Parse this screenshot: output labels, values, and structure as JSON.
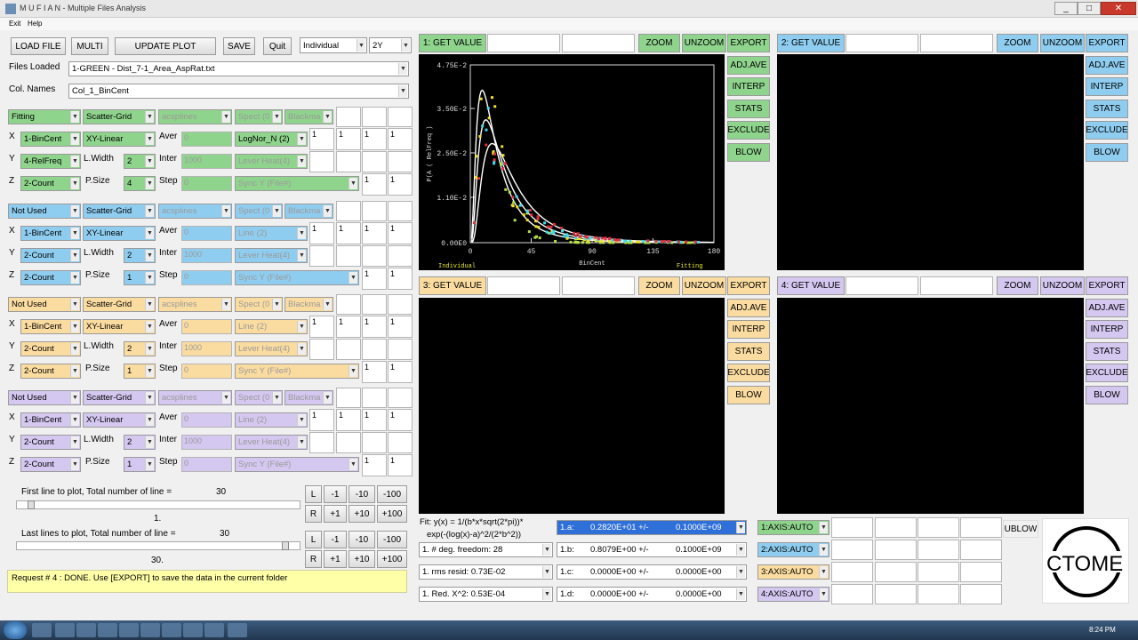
{
  "window": {
    "title": "M U F I A N - Multiple Files Analysis",
    "min": "_",
    "max": "□",
    "close": "✕"
  },
  "menu": {
    "exit": "Exit",
    "help": "Help"
  },
  "toolbar": {
    "load": "LOAD FILE",
    "multi": "MULTI",
    "update": "UPDATE PLOT",
    "save": "SAVE",
    "quit": "Quit",
    "mode": "Individual",
    "axes": "2Y"
  },
  "files_loaded": {
    "label": "Files Loaded",
    "value": "1-GREEN - Dist_7-1_Area_AspRat.txt"
  },
  "col_names": {
    "label": "Col. Names",
    "value": "Col_1_BinCent"
  },
  "groups": [
    {
      "mode": "Fitting",
      "style": "Scatter-Grid",
      "spline": "acsplines",
      "speed": "Spect (0",
      "window": "Blackma",
      "x": "1-BinCent",
      "scale": "XY-Linear",
      "aver": "0",
      "fitfn": "LogNor_N (2)",
      "y": "4-RelFreq",
      "lwidth": "2",
      "inter": "1000",
      "lever": "Lever Heat(4)",
      "z": "2-Count",
      "psize": "4",
      "step": "0",
      "sync": "Sync Y (File#)",
      "n": [
        "1",
        "1",
        "1",
        "1"
      ],
      "m": [
        "1",
        "1"
      ]
    },
    {
      "mode": "Not Used",
      "style": "Scatter-Grid",
      "spline": "acsplines",
      "speed": "Spect (0",
      "window": "Blackma",
      "x": "1-BinCent",
      "scale": "XY-Linear",
      "aver": "0",
      "fitfn": "Line (2)",
      "y": "2-Count",
      "lwidth": "2",
      "inter": "1000",
      "lever": "Lever Heat(4)",
      "z": "2-Count",
      "psize": "1",
      "step": "0",
      "sync": "Sync Y (File#)",
      "n": [
        "1",
        "1",
        "1",
        "1"
      ],
      "m": [
        "1",
        "1"
      ]
    },
    {
      "mode": "Not Used",
      "style": "Scatter-Grid",
      "spline": "acsplines",
      "speed": "Spect (0",
      "window": "Blackma",
      "x": "1-BinCent",
      "scale": "XY-Linear",
      "aver": "0",
      "fitfn": "Line (2)",
      "y": "2-Count",
      "lwidth": "2",
      "inter": "1000",
      "lever": "Lever Heat(4)",
      "z": "2-Count",
      "psize": "1",
      "step": "0",
      "sync": "Sync Y (File#)",
      "n": [
        "1",
        "1",
        "1",
        "1"
      ],
      "m": [
        "1",
        "1"
      ]
    },
    {
      "mode": "Not Used",
      "style": "Scatter-Grid",
      "spline": "acsplines",
      "speed": "Spect (0",
      "window": "Blackma",
      "x": "1-BinCent",
      "scale": "XY-Linear",
      "aver": "0",
      "fitfn": "Line (2)",
      "y": "2-Count",
      "lwidth": "2",
      "inter": "1000",
      "lever": "Lever Heat(4)",
      "z": "2-Count",
      "psize": "1",
      "step": "0",
      "sync": "Sync Y (File#)",
      "n": [
        "1",
        "1",
        "1",
        "1"
      ],
      "m": [
        "1",
        "1"
      ]
    }
  ],
  "labels": {
    "x": "X",
    "y": "Y",
    "z": "Z",
    "aver": "Aver",
    "lwidth": "L.Width",
    "inter": "Inter",
    "psize": "P.Size",
    "step": "Step"
  },
  "lines": {
    "first_label": "First line to plot, Total number of line =",
    "first_total": "30",
    "first_value": "1.",
    "last_label": "Last lines to plot, Total number of line =",
    "last_total": "30",
    "last_value": "30.",
    "btn": [
      "L",
      "-1",
      "-10",
      "-100",
      "R",
      "+1",
      "+10",
      "+100"
    ]
  },
  "request": "Request #     4 : DONE. Use [EXPORT] to save the data in the current folder",
  "panels": [
    {
      "get": "1: GET VALUE",
      "zoom": "ZOOM",
      "unzoom": "UNZOOM",
      "export": "EXPORT",
      "adj": "ADJ.AVE",
      "interp": "INTERP",
      "stats": "STATS",
      "exclude": "EXCLUDE",
      "blow": "BLOW"
    },
    {
      "get": "2: GET VALUE",
      "zoom": "ZOOM",
      "unzoom": "UNZOOM",
      "export": "EXPORT",
      "adj": "ADJ.AVE",
      "interp": "INTERP",
      "stats": "STATS",
      "exclude": "EXCLUDE",
      "blow": "BLOW"
    },
    {
      "get": "3: GET VALUE",
      "zoom": "ZOOM",
      "unzoom": "UNZOOM",
      "export": "EXPORT",
      "adj": "ADJ.AVE",
      "interp": "INTERP",
      "stats": "STATS",
      "exclude": "EXCLUDE",
      "blow": "BLOW"
    },
    {
      "get": "4: GET VALUE",
      "zoom": "ZOOM",
      "unzoom": "UNZOOM",
      "export": "EXPORT",
      "adj": "ADJ.AVE",
      "interp": "INTERP",
      "stats": "STATS",
      "exclude": "EXCLUDE",
      "blow": "BLOW"
    }
  ],
  "plot1": {
    "yticks": [
      "4.75E-2",
      "3.50E-2",
      "2.50E-2",
      "1.10E-2",
      "0.00E0"
    ],
    "xticks": [
      "0",
      "45",
      "90",
      "135",
      "180"
    ],
    "ylabel": "P(A ( RelFreq )",
    "xlabel": "BinCent",
    "mode": "Individual",
    "status": "Fitting"
  },
  "fit": {
    "formula": "Fit: y(x) = 1/(b*x*sqrt(2*pi))*",
    "formula2": "exp(-(log(x)-a)^2/(2*b^2))",
    "stats": [
      "1. # deg. freedom:     28",
      "1. rms resid: 0.73E-02",
      "1. Red. X^2: 0.53E-04"
    ],
    "params": [
      {
        "n": "1.a:",
        "v": "0.2820E+01 +/-",
        "e": "0.1000E+09"
      },
      {
        "n": "1.b:",
        "v": "0.8079E+00 +/-",
        "e": "0.1000E+09"
      },
      {
        "n": "1.c:",
        "v": "0.0000E+00 +/-",
        "e": "0.0000E+00"
      },
      {
        "n": "1.d:",
        "v": "0.0000E+00 +/-",
        "e": "0.0000E+00"
      }
    ]
  },
  "axis": [
    "1:AXIS:AUTO",
    "2:AXIS:AUTO",
    "3:AXIS:AUTO",
    "4:AXIS:AUTO"
  ],
  "ublow": "UBLOW",
  "logo": "CTOME",
  "clock": "8:24 PM",
  "colors": {
    "green": "#8fd48d",
    "blue": "#8fcdf0",
    "orange": "#fbdca0",
    "purple": "#d4c7f0"
  }
}
